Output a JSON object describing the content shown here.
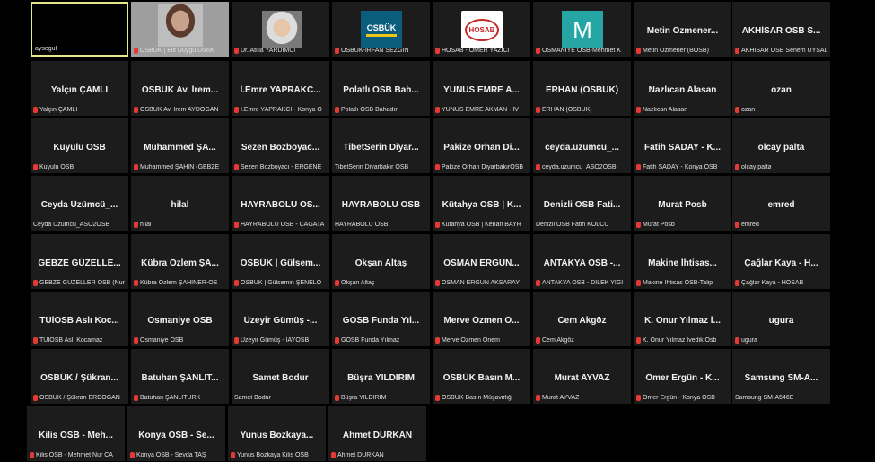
{
  "tiles": [
    {
      "name": "",
      "caption": "aysegul",
      "mic": false,
      "active": true
    },
    {
      "name": "",
      "caption": "OSBÜK | Elif Duygu DİRİK",
      "mic": true,
      "thumb": "photo"
    },
    {
      "name": "",
      "caption": "Dr. Atilla YARDIMCI",
      "mic": true,
      "thumb": "photo-man"
    },
    {
      "name": "",
      "caption": "OSBÜK-İRFAN SEZGİN",
      "mic": true,
      "thumb": "logo-osbuk",
      "thumb_text": "OSBÜK"
    },
    {
      "name": "",
      "caption": "HOSAB - ÖMER YAZICI",
      "mic": true,
      "thumb": "logo-hosab",
      "thumb_text": "HOSAB"
    },
    {
      "name": "",
      "caption": "OSMANİYE OSB-Mehmet K",
      "mic": true,
      "thumb": "letter",
      "thumb_text": "M"
    },
    {
      "name": "Metin Özmener...",
      "caption": "Metin Özmener (BOSB)",
      "mic": true
    },
    {
      "name": "AKHİSAR OSB S...",
      "caption": "AKHİSAR OSB Senem UYSAL",
      "mic": true
    },
    {
      "name": "Yalçın ÇAMLI",
      "caption": "Yalçın ÇAMLI",
      "mic": true
    },
    {
      "name": "OSBÜK Av. İrem...",
      "caption": "OSBÜK Av. İrem AYDOĞAN",
      "mic": true
    },
    {
      "name": "İ.Emre YAPRAKC...",
      "caption": "İ.Emre YAPRAKCI - Konya O",
      "mic": true
    },
    {
      "name": "Polatlı OSB Bah...",
      "caption": "Polatlı OSB Bahadır",
      "mic": true
    },
    {
      "name": "YUNUS EMRE A...",
      "caption": "YUNUS EMRE AKMAN - İV",
      "mic": true
    },
    {
      "name": "ERHAN (OSBUK)",
      "caption": "ERHAN (OSBUK)",
      "mic": true
    },
    {
      "name": "Nazlıcan Alasan",
      "caption": "Nazlıcan Alasan",
      "mic": true
    },
    {
      "name": "ozan",
      "caption": "ozan",
      "mic": true
    },
    {
      "name": "Kuyulu OSB",
      "caption": "Kuyulu OSB",
      "mic": true
    },
    {
      "name": "Muhammed ŞA...",
      "caption": "Muhammed ŞAHİN (GEBZE",
      "mic": true
    },
    {
      "name": "Sezen Bozboyac...",
      "caption": "Sezen Bozboyacı - ERGENE",
      "mic": true
    },
    {
      "name": "TibetSerin Diyar...",
      "caption": "TibetSerin Diyarbakır OSB",
      "mic": false
    },
    {
      "name": "Pakize Orhan Di...",
      "caption": "Pakize Orhan DiyarbakırOSB",
      "mic": true
    },
    {
      "name": "ceyda.uzumcu_...",
      "caption": "ceyda.uzumcu_ASO2OSB",
      "mic": true
    },
    {
      "name": "Fatih SADAY - K...",
      "caption": "Fatih SADAY - Konya OSB",
      "mic": true
    },
    {
      "name": "olcay palta",
      "caption": "olcay palta",
      "mic": true
    },
    {
      "name": "Ceyda Üzümcü_...",
      "caption": "Ceyda Üzümcü_ASO2OSB",
      "mic": false
    },
    {
      "name": "hilal",
      "caption": "hilal",
      "mic": true
    },
    {
      "name": "HAYRABOLU OS...",
      "caption": "HAYRABOLU OSB - ÇAĞATA",
      "mic": true
    },
    {
      "name": "HAYRABOLU OSB",
      "caption": "HAYRABOLU OSB",
      "mic": false
    },
    {
      "name": "Kütahya OSB | K...",
      "caption": "Kütahya OSB | Kenan BAYR",
      "mic": true
    },
    {
      "name": "Denizli OSB Fati...",
      "caption": "Denizli OSB Fatih KOLCU",
      "mic": false
    },
    {
      "name": "Murat Posb",
      "caption": "Murat Posb",
      "mic": true
    },
    {
      "name": "emred",
      "caption": "emred",
      "mic": true
    },
    {
      "name": "GEBZE GÜZELLE...",
      "caption": "GEBZE GÜZELLER OSB (Nur",
      "mic": true
    },
    {
      "name": "Kübra Özlem ŞA...",
      "caption": "Kübra Özlem ŞAHİNER-OS",
      "mic": true
    },
    {
      "name": "OSBÜK | Gülsem...",
      "caption": "OSBÜK | Gülsemin ŞENELO",
      "mic": true
    },
    {
      "name": "Okşan Altaş",
      "caption": "Okşan Altaş",
      "mic": true
    },
    {
      "name": "OSMAN ERGÜN...",
      "caption": "OSMAN ERGÜN AKSARAY",
      "mic": true
    },
    {
      "name": "ANTAKYA OSB -...",
      "caption": "ANTAKYA OSB - DİLEK YİĞİ",
      "mic": true
    },
    {
      "name": "Makine İhtisas...",
      "caption": "Makine İhtisas OSB-Talip",
      "mic": true
    },
    {
      "name": "Çağlar Kaya - H...",
      "caption": "Çağlar Kaya - HOSAB",
      "mic": true
    },
    {
      "name": "TÜİOSB Aslı Koc...",
      "caption": "TÜİOSB Aslı Kocamaz",
      "mic": true
    },
    {
      "name": "Osmaniye OSB",
      "caption": "Osmaniye OSB",
      "mic": true
    },
    {
      "name": "Üzeyir Gümüş -...",
      "caption": "Üzeyir Gümüş - İAYOSB",
      "mic": true
    },
    {
      "name": "GOSB Funda Yıl...",
      "caption": "GOSB Funda Yılmaz",
      "mic": true
    },
    {
      "name": "Merve Özmen Ö...",
      "caption": "Merve Özmen Önem",
      "mic": true
    },
    {
      "name": "Cem Akgöz",
      "caption": "Cem Akgöz",
      "mic": true
    },
    {
      "name": "K. Onur Yılmaz İ...",
      "caption": "K. Onur Yılmaz İvedik Osb",
      "mic": true
    },
    {
      "name": "ugura",
      "caption": "ugura",
      "mic": true
    },
    {
      "name": "OSBÜK / Şükran...",
      "caption": "OSBÜK / Şükran ERDOĞAN",
      "mic": true
    },
    {
      "name": "Batuhan ŞANLIT...",
      "caption": "Batuhan ŞANLITÜRK",
      "mic": true
    },
    {
      "name": "Samet Bodur",
      "caption": "Samet Bodur",
      "mic": false
    },
    {
      "name": "Büşra YILDIRIM",
      "caption": "Büşra YILDIRIM",
      "mic": true
    },
    {
      "name": "OSBÜK Basın M...",
      "caption": "OSBÜK Basın Müşavirliği",
      "mic": true
    },
    {
      "name": "Murat AYVAZ",
      "caption": "Murat AYVAZ",
      "mic": true
    },
    {
      "name": "Ömer Ergün - K...",
      "caption": "Ömer Ergün - Konya OSB",
      "mic": true
    },
    {
      "name": "Samsung SM-A...",
      "caption": "Samsung SM-A546E",
      "mic": false
    },
    {
      "name": "Kilis OSB - Meh...",
      "caption": "Kilis OSB - Mehmet Nur CA",
      "mic": true
    },
    {
      "name": "Konya OSB - Se...",
      "caption": "Konya OSB - Sevda TAŞ",
      "mic": true
    },
    {
      "name": "Yunus Bozkaya...",
      "caption": "Yunus Bozkaya Kilis OSB",
      "mic": true
    },
    {
      "name": "Ahmet DURKAN",
      "caption": "Ahmet DURKAN",
      "mic": true
    }
  ]
}
